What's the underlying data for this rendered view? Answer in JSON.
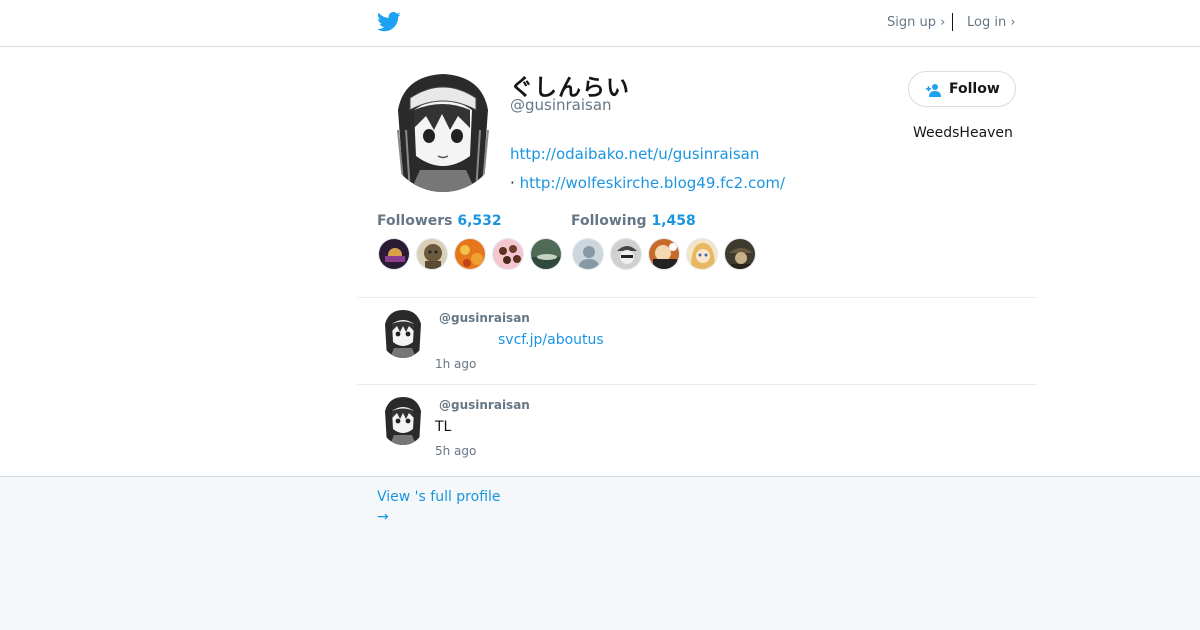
{
  "header": {
    "logo_icon": "twitter-bird-icon",
    "brand_color": "#1da1f2",
    "signup_label": "Sign up ›",
    "login_label": "Log in ›"
  },
  "profile": {
    "display_name": "ぐしんらい",
    "handle": "@gusinraisan",
    "url1": "http://odaibako.net/u/gusinraisan",
    "url2_prefix": "·",
    "url2": "http://wolfeskirche.blog49.fc2.com/",
    "location": "WeedsHeaven",
    "follow_label": "Follow",
    "follow_icon": "add-person-icon"
  },
  "stats": {
    "followers_label": "Followers",
    "followers_count": "6,532",
    "following_label": "Following",
    "following_count": "1,458"
  },
  "follower_avatars": [
    {
      "color": "#3a2540"
    },
    {
      "color": "#8a7d5c"
    },
    {
      "color": "#e07b20"
    },
    {
      "color": "#6b3e2a"
    },
    {
      "color": "#4f6a55"
    }
  ],
  "following_avatars": [
    {
      "color": "#aab8c2"
    },
    {
      "color": "#8f8f8f"
    },
    {
      "color": "#c86a2c"
    },
    {
      "color": "#e8b860"
    },
    {
      "color": "#5a4a38"
    }
  ],
  "tweets": [
    {
      "handle": "@gusinraisan",
      "text": "",
      "link": "svcf.jp/aboutus",
      "time": "1h ago"
    },
    {
      "handle": "@gusinraisan",
      "text": "TL",
      "link": "",
      "time": "5h ago"
    }
  ],
  "footer": {
    "full_profile_label": "View 's full profile",
    "arrow": "→"
  },
  "colors": {
    "link": "#1b95e0",
    "muted": "#657786",
    "background": "#f5f8fa"
  }
}
